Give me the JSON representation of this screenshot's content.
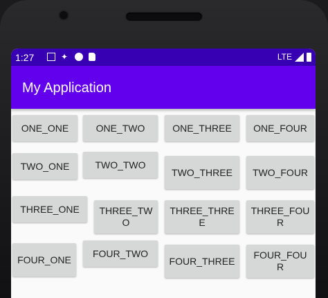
{
  "status_bar": {
    "time": "1:27",
    "network": "LTE"
  },
  "app_bar": {
    "title": "My Application"
  },
  "buttons": {
    "one_one": "ONE_ONE",
    "one_two": "ONE_TWO",
    "one_three": "ONE_THREE",
    "one_four": "ONE_FOUR",
    "two_one": "TWO_ONE",
    "two_two": "TWO_TWO",
    "two_three": "TWO_THREE",
    "two_four": "TWO_FOUR",
    "three_one": "THREE_ONE",
    "three_two": "THREE_TWO",
    "three_three": "THREE_THREE",
    "three_four": "THREE_FOUR",
    "four_one": "FOUR_ONE",
    "four_two": "FOUR_TWO",
    "four_three": "FOUR_THREE",
    "four_four": "FOUR_FOUR"
  },
  "colors": {
    "status_bar": "#3700b3",
    "app_bar": "#6200ee",
    "button": "#d6d7d7"
  }
}
